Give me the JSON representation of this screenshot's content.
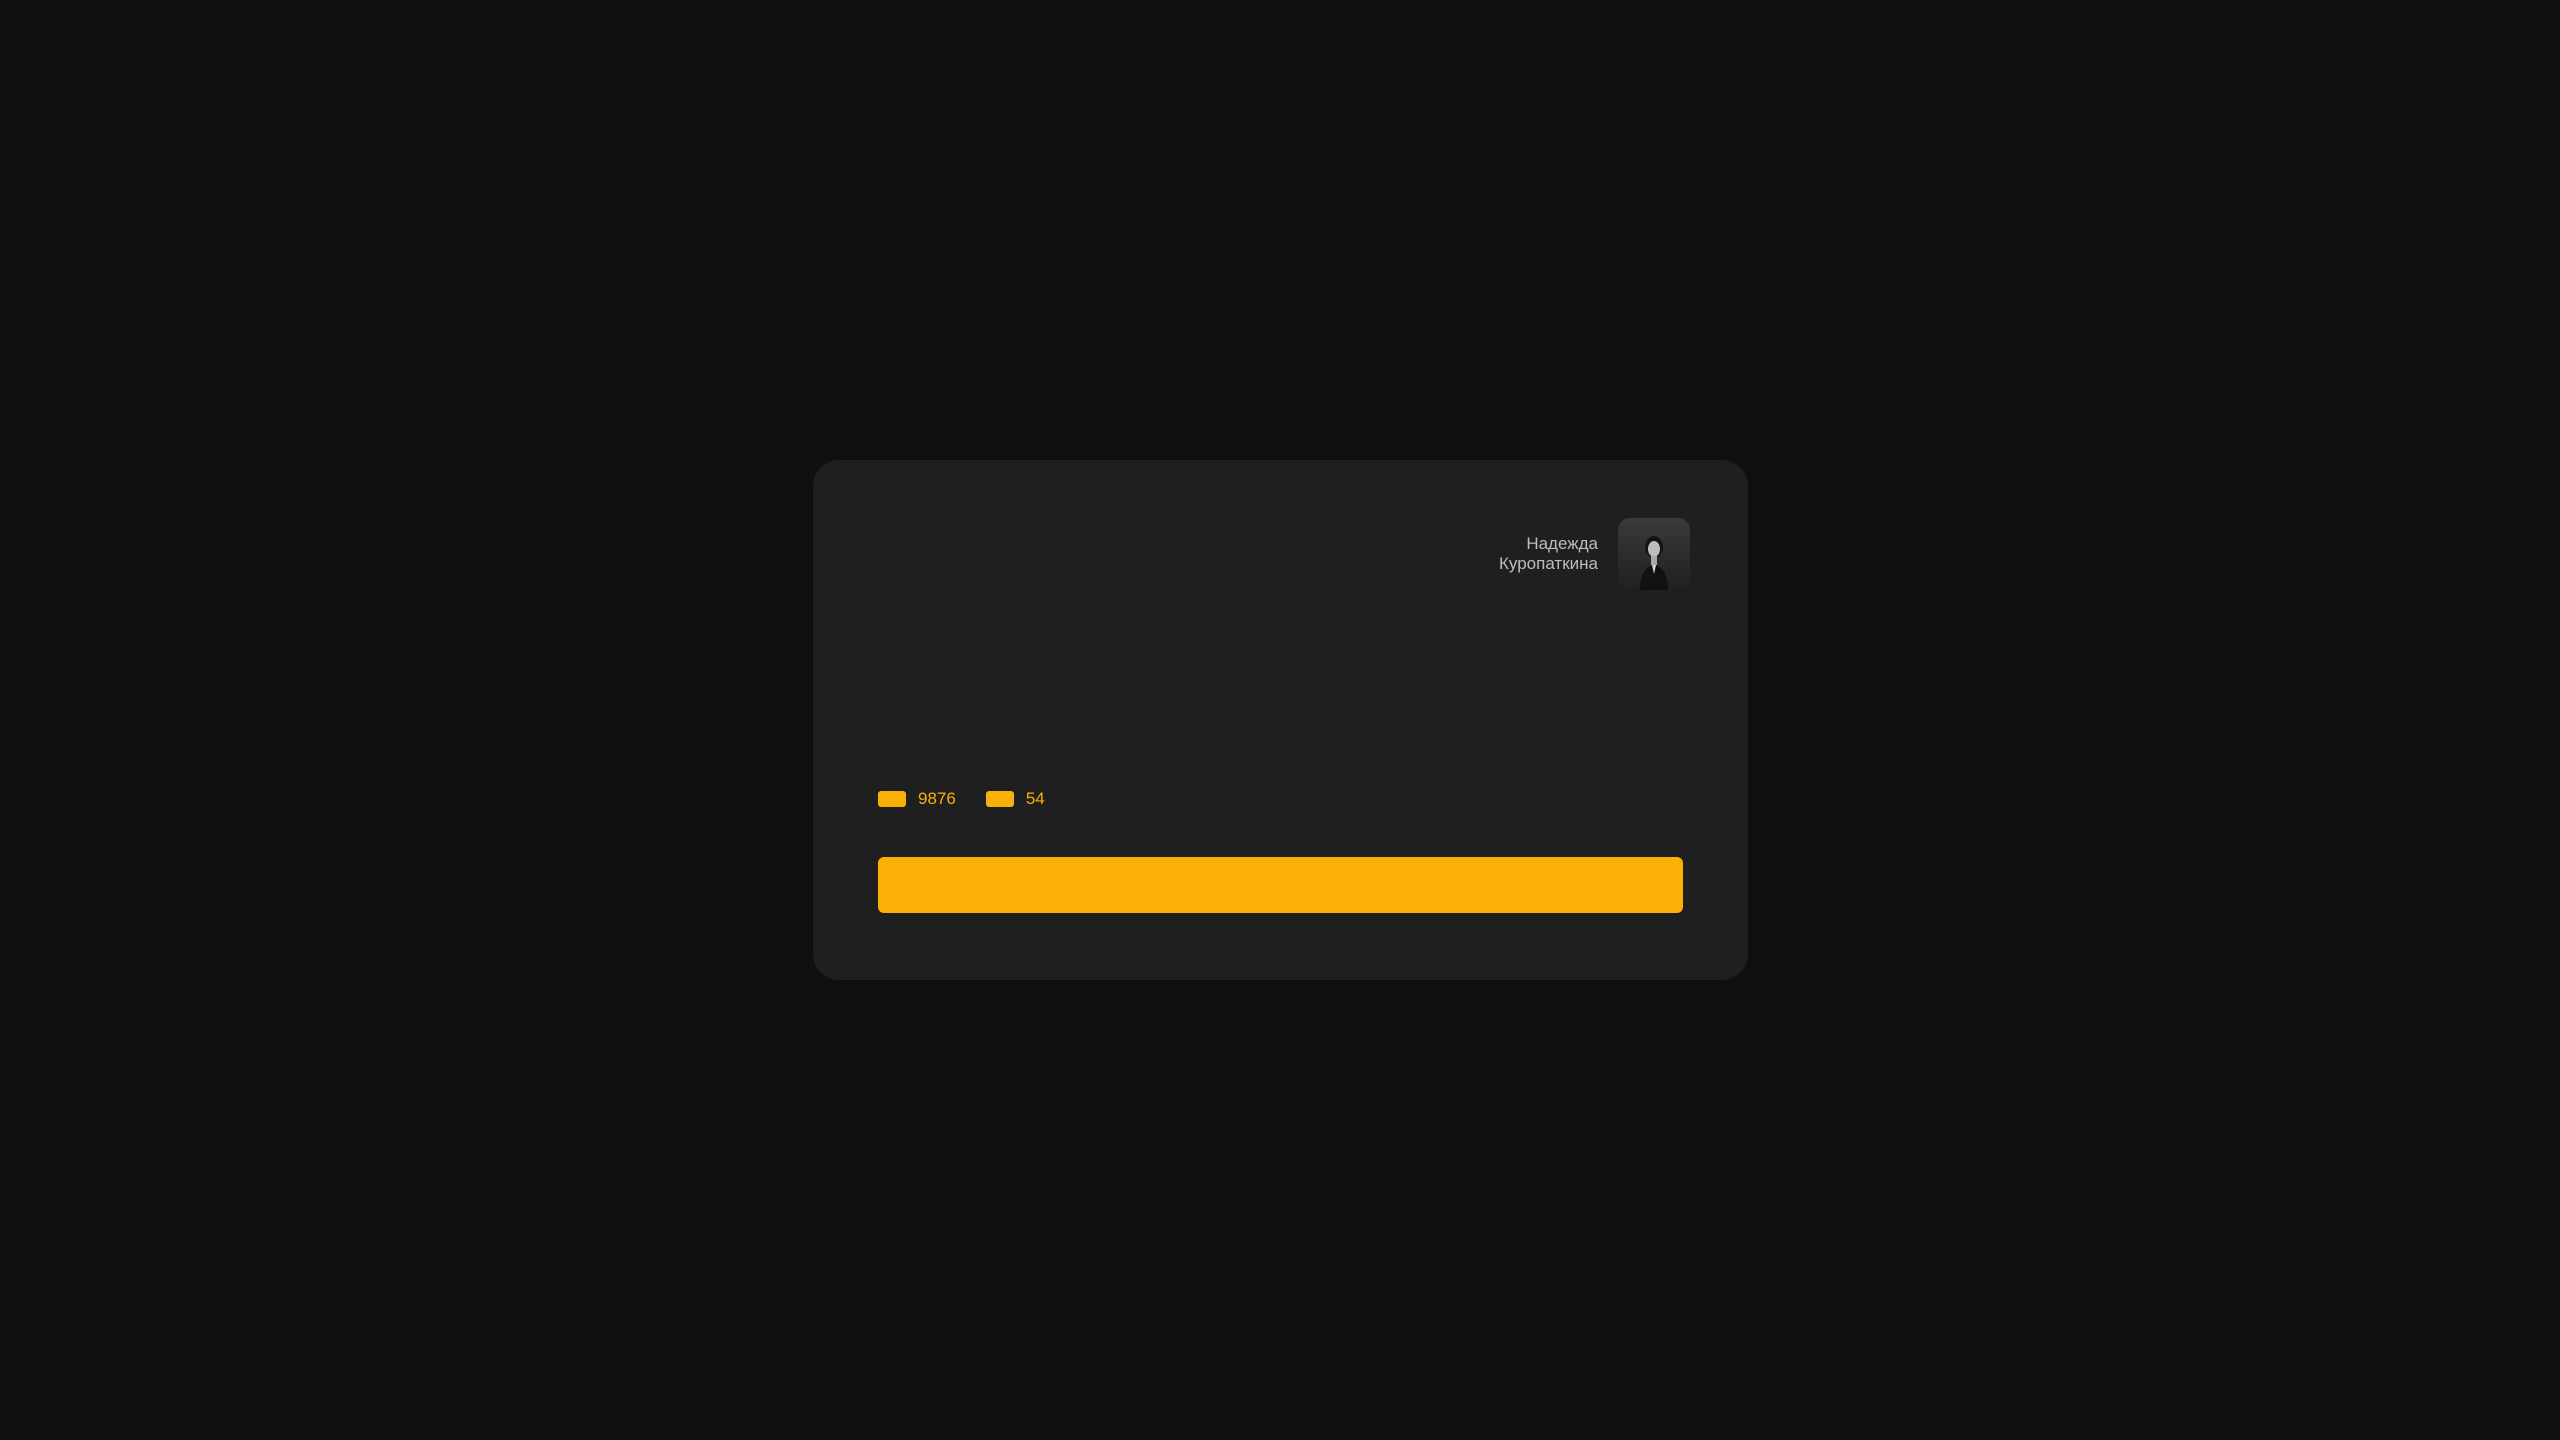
{
  "author": {
    "first_name": "Надежда",
    "last_name": "Куропаткина",
    "avatar_icon": "person-photo-icon"
  },
  "stats": [
    {
      "icon": "orange-pill-icon",
      "value": "9876"
    },
    {
      "icon": "orange-pill-icon",
      "value": "54"
    }
  ],
  "action": {
    "label": ""
  },
  "colors": {
    "background": "#0f0f0f",
    "card": "#1f1f1f",
    "accent": "#fbb006",
    "text_muted": "#bdbdbd"
  }
}
